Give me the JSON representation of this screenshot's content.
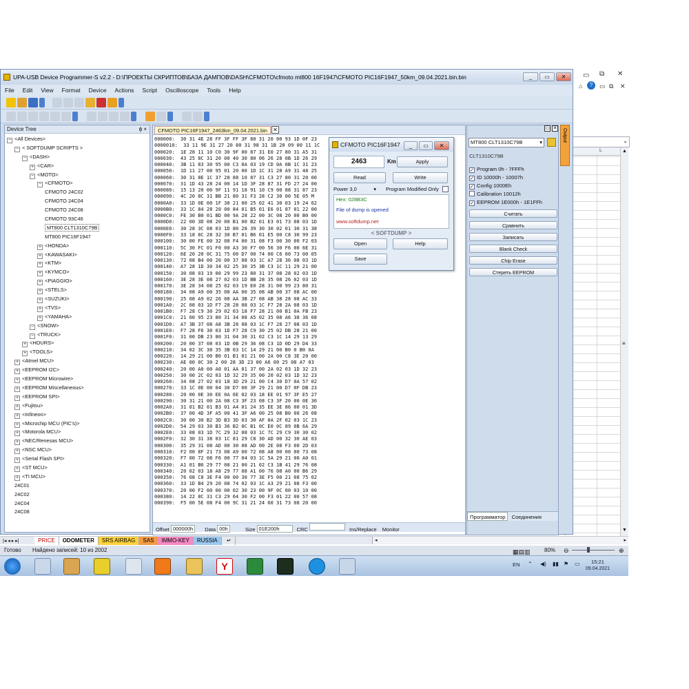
{
  "app": {
    "title": "UPA-USB Device Programmer-S v2.2 - D:\\ПРОЕКТЫ СКРИПТОВ\\БАЗА ДАМПОВ\\DASH\\CFMOTO\\cfmoto mt800 16F1947\\CFMOTO PIC16F1947_50km_09.04.2021.bin.bin",
    "menu": [
      "File",
      "Edit",
      "View",
      "Format",
      "Device",
      "Actions",
      "Script",
      "Oscilloscope",
      "Tools",
      "Help"
    ]
  },
  "tree": {
    "title": "Device Tree",
    "pin": "ɸ ×",
    "items": [
      {
        "label": "<All Devices>",
        "indent": 0,
        "toggle": "−"
      },
      {
        "label": "< SOFTDUMP SCRIPTS >",
        "indent": 1,
        "toggle": "−"
      },
      {
        "label": "<DASH>",
        "indent": 2,
        "toggle": "−"
      },
      {
        "label": "<CAR>",
        "indent": 3,
        "toggle": "+"
      },
      {
        "label": "<MOTO>",
        "indent": 3,
        "toggle": "−"
      },
      {
        "label": "<CFMOTO>",
        "indent": 4,
        "toggle": "−"
      },
      {
        "label": "CFMOTO 24C02",
        "indent": 5,
        "toggle": ""
      },
      {
        "label": "CFMOTO 24C04",
        "indent": 5,
        "toggle": ""
      },
      {
        "label": "CFMOTO 24C08",
        "indent": 5,
        "toggle": ""
      },
      {
        "label": "CFMOTO 93C46",
        "indent": 5,
        "toggle": ""
      },
      {
        "label": "MT800 CLT1310C79B",
        "indent": 5,
        "toggle": "",
        "selected": true
      },
      {
        "label": "MT800 PIC16F1947",
        "indent": 5,
        "toggle": ""
      },
      {
        "label": "<HONDA>",
        "indent": 4,
        "toggle": "+"
      },
      {
        "label": "<KAWASAKI>",
        "indent": 4,
        "toggle": "+"
      },
      {
        "label": "<KTM>",
        "indent": 4,
        "toggle": "+"
      },
      {
        "label": "<KYMCO>",
        "indent": 4,
        "toggle": "+"
      },
      {
        "label": "<PIAGGIO>",
        "indent": 4,
        "toggle": "+"
      },
      {
        "label": "<STELS>",
        "indent": 4,
        "toggle": "+"
      },
      {
        "label": "<SUZUKI>",
        "indent": 4,
        "toggle": "+"
      },
      {
        "label": "<TVS>",
        "indent": 4,
        "toggle": "+"
      },
      {
        "label": "<YAMAHA>",
        "indent": 4,
        "toggle": "+"
      },
      {
        "label": "<SNOW>",
        "indent": 3,
        "toggle": "−"
      },
      {
        "label": "<TRUCK>",
        "indent": 3,
        "toggle": "−"
      },
      {
        "label": "<HOURS>",
        "indent": 2,
        "toggle": "+"
      },
      {
        "label": "<TOOLS>",
        "indent": 2,
        "toggle": "+"
      },
      {
        "label": "<Atmel MCU>",
        "indent": 1,
        "toggle": "+"
      },
      {
        "label": "<EEPROM I2C>",
        "indent": 1,
        "toggle": "+"
      },
      {
        "label": "<EEPROM Microwire>",
        "indent": 1,
        "toggle": "+"
      },
      {
        "label": "<EEPROM Miscellaneous>",
        "indent": 1,
        "toggle": "+"
      },
      {
        "label": "<EEPROM SPI>",
        "indent": 1,
        "toggle": "+"
      },
      {
        "label": "<Fujitsu>",
        "indent": 1,
        "toggle": "+"
      },
      {
        "label": "<Infineon>",
        "indent": 1,
        "toggle": "+"
      },
      {
        "label": "<Microchip MCU (PIC's)>",
        "indent": 1,
        "toggle": "+"
      },
      {
        "label": "<Motorola MCU>",
        "indent": 1,
        "toggle": "+"
      },
      {
        "label": "<NEC/Renesas MCU>",
        "indent": 1,
        "toggle": "+"
      },
      {
        "label": "<NSC MCU>",
        "indent": 1,
        "toggle": "+"
      },
      {
        "label": "<Serial Flash SPI>",
        "indent": 1,
        "toggle": "+"
      },
      {
        "label": "<ST MCU>",
        "indent": 1,
        "toggle": "+"
      },
      {
        "label": "<TI MCU>",
        "indent": 1,
        "toggle": "+"
      },
      {
        "label": "24C01",
        "indent": 1,
        "toggle": ""
      },
      {
        "label": "24C02",
        "indent": 1,
        "toggle": ""
      },
      {
        "label": "24C04",
        "indent": 1,
        "toggle": ""
      },
      {
        "label": "24C08",
        "indent": 1,
        "toggle": ""
      }
    ]
  },
  "hex": {
    "tab": "CFMOTO PIC16F1947_2463km_09.04.2021.bin",
    "lines": [
      "000000:  30 31 4E 28 FF 3F FF 3F 80 31 20 00 93 1D 0F 23",
      "0000010:  33 11 9E 31 27 20 80 31 98 31 1B 20 09 00 11 1C",
      "000020:  1E 28 11 10 C0 30 9F 00 87 31 E0 27 80 31 A5 31",
      "000030:  43 25 8C 31 20 00 40 30 80 06 26 28 0B 1D 26 29",
      "000040:  3B 11 83 30 95 00 C3 0A 03 19 CD 0A 0B 1C 31 23",
      "000050:  1D 11 27 00 95 01 20 00 1D 1C 31 28 A9 31 48 25",
      "000060:  30 31 8E 1C 37 28 88 10 87 31 C3 27 80 31 20 00",
      "000070:  31 1D 43 28 24 00 14 1D 3F 28 87 31 FD 27 24 00",
      "000080:  15 13 20 00 9F 11 91 18 91 10 C9 00 88 31 87 23",
      "000090:  4C 20 8C 31 BB 21 80 31 F3 28 C2 30 00 5E 05 M",
      "0000A0:  33 1D 0E 00 1F 30 21 00 25 02 41 30 03 19 24 02",
      "0000B0:  33 1C 84 28 20 00 84 01 B5 01 E6 01 87 01 22 00",
      "0000C0:  FE 30 B0 01 BD 00 9A 28 22 00 3C 08 20 00 B0 00",
      "0000D0:  22 00 3D 08 20 00 B1 00 B2 01 E3 01 73 08 03 1D",
      "0000E0:  30 28 3C 08 03 1D 80 28 39 30 30 02 01 30 31 38",
      "0000F0:  33 18 8C 28 32 30 B7 01 B6 01 E5 00 C8 30 99 23",
      "000100:  30 00 FE 00 32 08 F4 00 31 08 F3 00 30 00 F2 03",
      "000110:  5C 30 FC 01 F0 00 A3 30 F7 00 56 30 F6 00 6E 31",
      "000120:  6E 20 20 0C 31 75 00 D7 00 74 00 C6 00 73 00 05",
      "000130:  72 08 B4 00 20 00 37 08 03 1C A7 28 36 08 03 1D",
      "000140:  A7 28 1D 30 34 02 25 30 35 3B C3 1C 11 29 21 00",
      "000150:  30 08 03 19 00 29 99 23 80 31 37 08 28 02 03 1D",
      "000160:  3E 28 3E 08 27 02 03 1D BB 28 35 08 26 02 03 1D",
      "000170:  3E 28 34 08 25 02 03 19 E0 28 31 00 99 23 80 31",
      "000180:  34 08 A9 00 35 08 AA 00 35 08 AB 00 37 08 AC 00",
      "000190:  25 08 A9 02 26 08 AA 3B 27 08 AB 38 28 08 AC 33",
      "0001A0:  2C 08 03 1D F7 28 28 08 03 1C F7 28 2A 08 03 1D",
      "0001B0:  F7 28 C9 30 29 02 03 18 F7 28 21 00 B1 0A FB 23",
      "0001C0:  21 00 95 23 80 31 34 08 A5 02 35 08 A6 38 36 08",
      "0001D0:  A7 3B 37 08 A8 3B 28 08 03 1C F7 28 27 08 03 1D",
      "0001E0:  F7 28 F6 30 03 1D F7 28 C9 30 25 02 DB 28 21 00",
      "0001F0:  31 00 DB 23 80 31 04 30 31 02 C3 1C 14 29 13 29",
      "000200:  20 00 37 08 03 1D 0B 29 36 08 C3 1D 0D 29 D4 33",
      "000210:  34 02 3C 30 35 3B 03 1C 14 29 21 00 B0 0 B0 0A",
      "000220:  14 29 21 00 B0 01 B1 01 21 00 2A 00 C8 3E 20 00",
      "000230:  AE 00 0C 30 2 00 28 3D 23 00 A6 00 25 08 A7 03",
      "000240:  20 00 A0 00 A0 01 AA 01 37 00 2A 02 03 1D 32 23",
      "000250:  30 00 2C 02 03 1D 32 29 35 00 20 02 03 1D 32 23",
      "000260:  34 08 27 02 03 18 3D 29 21 00 C4 30 D7 0A 57 02",
      "000270:  33 1C 0E 00 04 30 D7 00 3F 29 21 00 D7 0F DB 23",
      "000280:  20 00 0E 30 EE 0A 6E 02 03 18 EE 01 97 3F E5 27",
      "000290:  30 31 21 00 2A 08 C3 3F 23 08 C3 3F 20 00 0E 30",
      "0002A0:  31 01 B2 01 B3 01 A4 01 24 35 EE 3E 86 00 01 3D",
      "0002B0:  37 00 4D 3F A5 00 41 3F A6 00 25 08 B0 00 26 08",
      "0002C0:  30 00 30 B2 3D B3 3D 03 30 AF 0A 2F 02 03 1C 23",
      "0002D0:  54 29 03 30 B3 36 B2 0C B1 0C E0 0C 89 0B 6A 29",
      "0002E0:  33 08 03 1D 7C 29 32 08 03 1C 7C 29 C9 30 30 02",
      "0002F0:  32 30 31 38 03 1C 81 29 C8 30 AD 00 32 30 AE 03",
      "000300:  35 29 31 08 AD 00 30 08 AD 00 2E 08 F3 00 2D 03",
      "000310:  F2 00 8F 21 73 08 A9 00 72 08 A8 00 00 00 73 08",
      "000320:  F7 00 72 08 F6 00 77 04 03 1C 5A 29 21 00 A0 01",
      "000330:  A1 01 B6 29 77 08 21 00 21 02 C3 1B 41 29 76 08",
      "000340:  20 02 03 18 A8 29 77 08 A1 00 76 08 A0 00 B6 29",
      "000350:  76 08 C8 3E F4 00 00 30 77 3E F5 00 21 08 75 02",
      "000360:  33 1D B4 29 20 08 74 02 03 1C A3 29 21 08 F3 00",
      "000370:  20 00 F2 00 00 00 02 30 23 00 9F 0C 00 03 10 00",
      "000380:  14 22 8C 31 C3 29 64 30 F2 00 F3 01 22 00 57 08",
      "000390:  F5 00 5E 08 F4 00 9C 31 21 24 60 31 73 08 20 00"
    ],
    "status": {
      "offset_label": "Offset",
      "offset_value": "000000h",
      "data_label": "Data",
      "data_value": "00h",
      "size_label": "Size",
      "size_value": "01E200h",
      "crc_label": "CRC",
      "mode": "Ins/Replace",
      "monitor": "Monitor"
    }
  },
  "dialog": {
    "title": "CFMOTO PIC16F1947",
    "km_value": "2463",
    "km_label": "Km",
    "apply": "Apply",
    "read": "Read",
    "write": "Write",
    "power": "Power 3,0",
    "prog_modified": "Program Modified Only",
    "hex_line": "Hex: 028B3C",
    "info_line": "File of dump is opened",
    "url": "www.softdump.net",
    "brand": "< SOFTDUMP >",
    "open": "Open",
    "help": "Help",
    "save": "Save"
  },
  "rpanel": {
    "device": "MT800 CLT1310C79B",
    "device_sub": "CLT1310C79B",
    "options": [
      {
        "label": "Program 0h - 7FFFh",
        "checked": true
      },
      {
        "label": "ID 10000h - 10007h",
        "checked": true
      },
      {
        "label": "Config 1000Eh",
        "checked": true
      },
      {
        "label": "Calibration 10012h",
        "checked": false
      },
      {
        "label": "EEPROM 1E000h - 1E1FFh",
        "checked": true
      }
    ],
    "buttons": [
      "Считать",
      "Сравнить",
      "Записать",
      "Blank Check",
      "Chip Erase",
      "Стереть EEPROM"
    ],
    "tabs": [
      "Программатор",
      "Соединения"
    ],
    "output_tab": "Output"
  },
  "excel": {
    "col_l": "L",
    "sheets": [
      {
        "name": "PRICE",
        "color": "#ffffff",
        "text": "#c00000"
      },
      {
        "name": "ODOMETER",
        "color": "#ffffff",
        "text": "#000000",
        "active": true
      },
      {
        "name": "SRS AIRBAG",
        "color": "#ffd23a",
        "text": "#000000"
      },
      {
        "name": "SAS",
        "color": "#f39a45",
        "text": "#000000"
      },
      {
        "name": "IMMO-KEY",
        "color": "#f28ac2",
        "text": "#000000"
      },
      {
        "name": "RUSSIA",
        "color": "#9bc8ef",
        "text": "#000000"
      }
    ],
    "status_left": "Готово",
    "status_records": "Найдено записей: 10 из 2002",
    "zoom": "80%"
  },
  "taskbar": {
    "lang": "EN",
    "time": "15:21",
    "date": "09.04.2021"
  }
}
